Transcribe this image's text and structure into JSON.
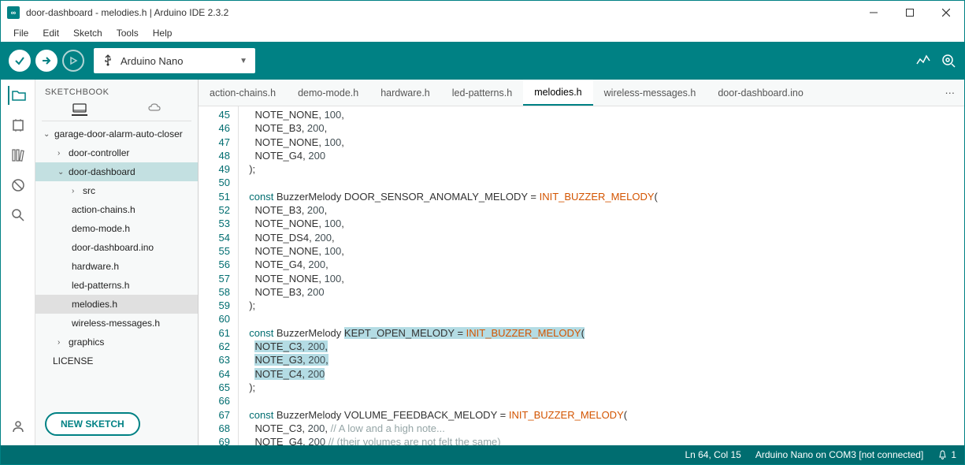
{
  "window": {
    "title": "door-dashboard - melodies.h | Arduino IDE 2.3.2"
  },
  "menu": [
    "File",
    "Edit",
    "Sketch",
    "Tools",
    "Help"
  ],
  "board": "Arduino Nano",
  "sidebar": {
    "title": "SKETCHBOOK",
    "tree": {
      "project": "garage-door-alarm-auto-closer",
      "door_controller": "door-controller",
      "door_dashboard": "door-dashboard",
      "src": "src",
      "files": [
        "action-chains.h",
        "demo-mode.h",
        "door-dashboard.ino",
        "hardware.h",
        "led-patterns.h",
        "melodies.h",
        "wireless-messages.h"
      ],
      "graphics": "graphics",
      "license": "LICENSE"
    },
    "new_sketch": "NEW SKETCH"
  },
  "tabs": [
    "action-chains.h",
    "demo-mode.h",
    "hardware.h",
    "led-patterns.h",
    "melodies.h",
    "wireless-messages.h",
    "door-dashboard.ino"
  ],
  "active_tab": "melodies.h",
  "editor": {
    "first_line": 45,
    "lines": [
      [
        {
          "t": "    NOTE_NONE, "
        },
        {
          "t": "100",
          "c": "num"
        },
        {
          "t": ","
        }
      ],
      [
        {
          "t": "    NOTE_B3, "
        },
        {
          "t": "200",
          "c": "num"
        },
        {
          "t": ","
        }
      ],
      [
        {
          "t": "    NOTE_NONE, "
        },
        {
          "t": "100",
          "c": "num"
        },
        {
          "t": ","
        }
      ],
      [
        {
          "t": "    NOTE_G4, "
        },
        {
          "t": "200",
          "c": "num"
        }
      ],
      [
        {
          "t": "  );"
        }
      ],
      [],
      [
        {
          "t": "  "
        },
        {
          "t": "const",
          "c": "kw"
        },
        {
          "t": " BuzzerMelody DOOR_SENSOR_ANOMALY_MELODY = "
        },
        {
          "t": "INIT_BUZZER_MELODY",
          "c": "fn"
        },
        {
          "t": "("
        }
      ],
      [
        {
          "t": "    NOTE_B3, "
        },
        {
          "t": "200",
          "c": "num"
        },
        {
          "t": ","
        }
      ],
      [
        {
          "t": "    NOTE_NONE, "
        },
        {
          "t": "100",
          "c": "num"
        },
        {
          "t": ","
        }
      ],
      [
        {
          "t": "    NOTE_DS4, "
        },
        {
          "t": "200",
          "c": "num"
        },
        {
          "t": ","
        }
      ],
      [
        {
          "t": "    NOTE_NONE, "
        },
        {
          "t": "100",
          "c": "num"
        },
        {
          "t": ","
        }
      ],
      [
        {
          "t": "    NOTE_G4, "
        },
        {
          "t": "200",
          "c": "num"
        },
        {
          "t": ","
        }
      ],
      [
        {
          "t": "    NOTE_NONE, "
        },
        {
          "t": "100",
          "c": "num"
        },
        {
          "t": ","
        }
      ],
      [
        {
          "t": "    NOTE_B3, "
        },
        {
          "t": "200",
          "c": "num"
        }
      ],
      [
        {
          "t": "  );"
        }
      ],
      [],
      [
        {
          "t": "  "
        },
        {
          "t": "const",
          "c": "kw"
        },
        {
          "t": " BuzzerMelody "
        },
        {
          "t": "KEPT_OPEN_MELODY = ",
          "c": "hl"
        },
        {
          "t": "INIT_BUZZER_MELODY",
          "c": "fn hl"
        },
        {
          "t": "(",
          "c": "hl"
        }
      ],
      [
        {
          "t": "    "
        },
        {
          "t": "NOTE_C3, ",
          "c": "hl"
        },
        {
          "t": "200",
          "c": "num hl"
        },
        {
          "t": ",",
          "c": "hl"
        }
      ],
      [
        {
          "t": "    "
        },
        {
          "t": "NOTE_G3, ",
          "c": "hl"
        },
        {
          "t": "200",
          "c": "num hl"
        },
        {
          "t": ",",
          "c": "hl"
        }
      ],
      [
        {
          "t": "    "
        },
        {
          "t": "NOTE_C4, ",
          "c": "hl"
        },
        {
          "t": "200",
          "c": "num hl"
        }
      ],
      [
        {
          "t": "  );"
        }
      ],
      [],
      [
        {
          "t": "  "
        },
        {
          "t": "const",
          "c": "kw"
        },
        {
          "t": " BuzzerMelody VOLUME_FEEDBACK_MELODY = "
        },
        {
          "t": "INIT_BUZZER_MELODY",
          "c": "fn"
        },
        {
          "t": "("
        }
      ],
      [
        {
          "t": "    NOTE_C3, "
        },
        {
          "t": "200",
          "c": "num"
        },
        {
          "t": ", "
        },
        {
          "t": "// A low and a high note...",
          "c": "cm"
        }
      ],
      [
        {
          "t": "    NOTE_G4, "
        },
        {
          "t": "200",
          "c": "num"
        },
        {
          "t": " "
        },
        {
          "t": "// (their volumes are not felt the same)",
          "c": "cm"
        }
      ],
      [
        {
          "t": "  );"
        }
      ]
    ]
  },
  "status": {
    "cursor": "Ln 64, Col 15",
    "board_info": "Arduino Nano on COM3 [not connected]",
    "notifications": "1"
  }
}
